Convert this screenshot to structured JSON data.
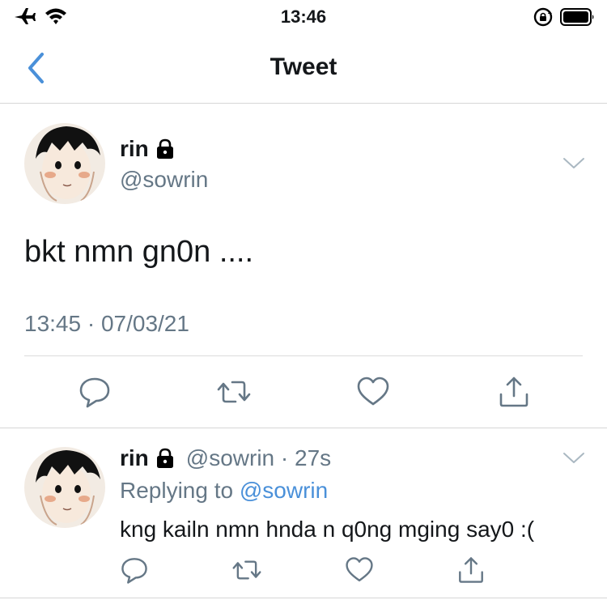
{
  "status_bar": {
    "time": "13:46",
    "icons": [
      "airplane-icon",
      "wifi-icon",
      "rotation-lock-icon",
      "battery-icon"
    ]
  },
  "nav": {
    "title": "Tweet",
    "back_icon": "chevron-left-icon"
  },
  "colors": {
    "accent": "#4a90d9",
    "text": "#14171a",
    "secondary": "#657786",
    "divider": "#d6d6d6"
  },
  "main_tweet": {
    "display_name": "rin",
    "handle": "@sowrin",
    "text": "bkt nmn gn0n ....",
    "meta": "13:45 · 07/03/21",
    "actions": [
      "reply-icon",
      "retweet-icon",
      "like-icon",
      "share-icon"
    ]
  },
  "reply_tweet": {
    "display_name": "rin",
    "handle_time": "@sowrin · 27s",
    "replying_prefix": "Replying to",
    "replying_handle": "@sowrin",
    "text": "kng kailn nmn hnda n q0ng mging say0 :(",
    "actions": [
      "reply-icon",
      "retweet-icon",
      "like-icon",
      "share-icon"
    ]
  }
}
